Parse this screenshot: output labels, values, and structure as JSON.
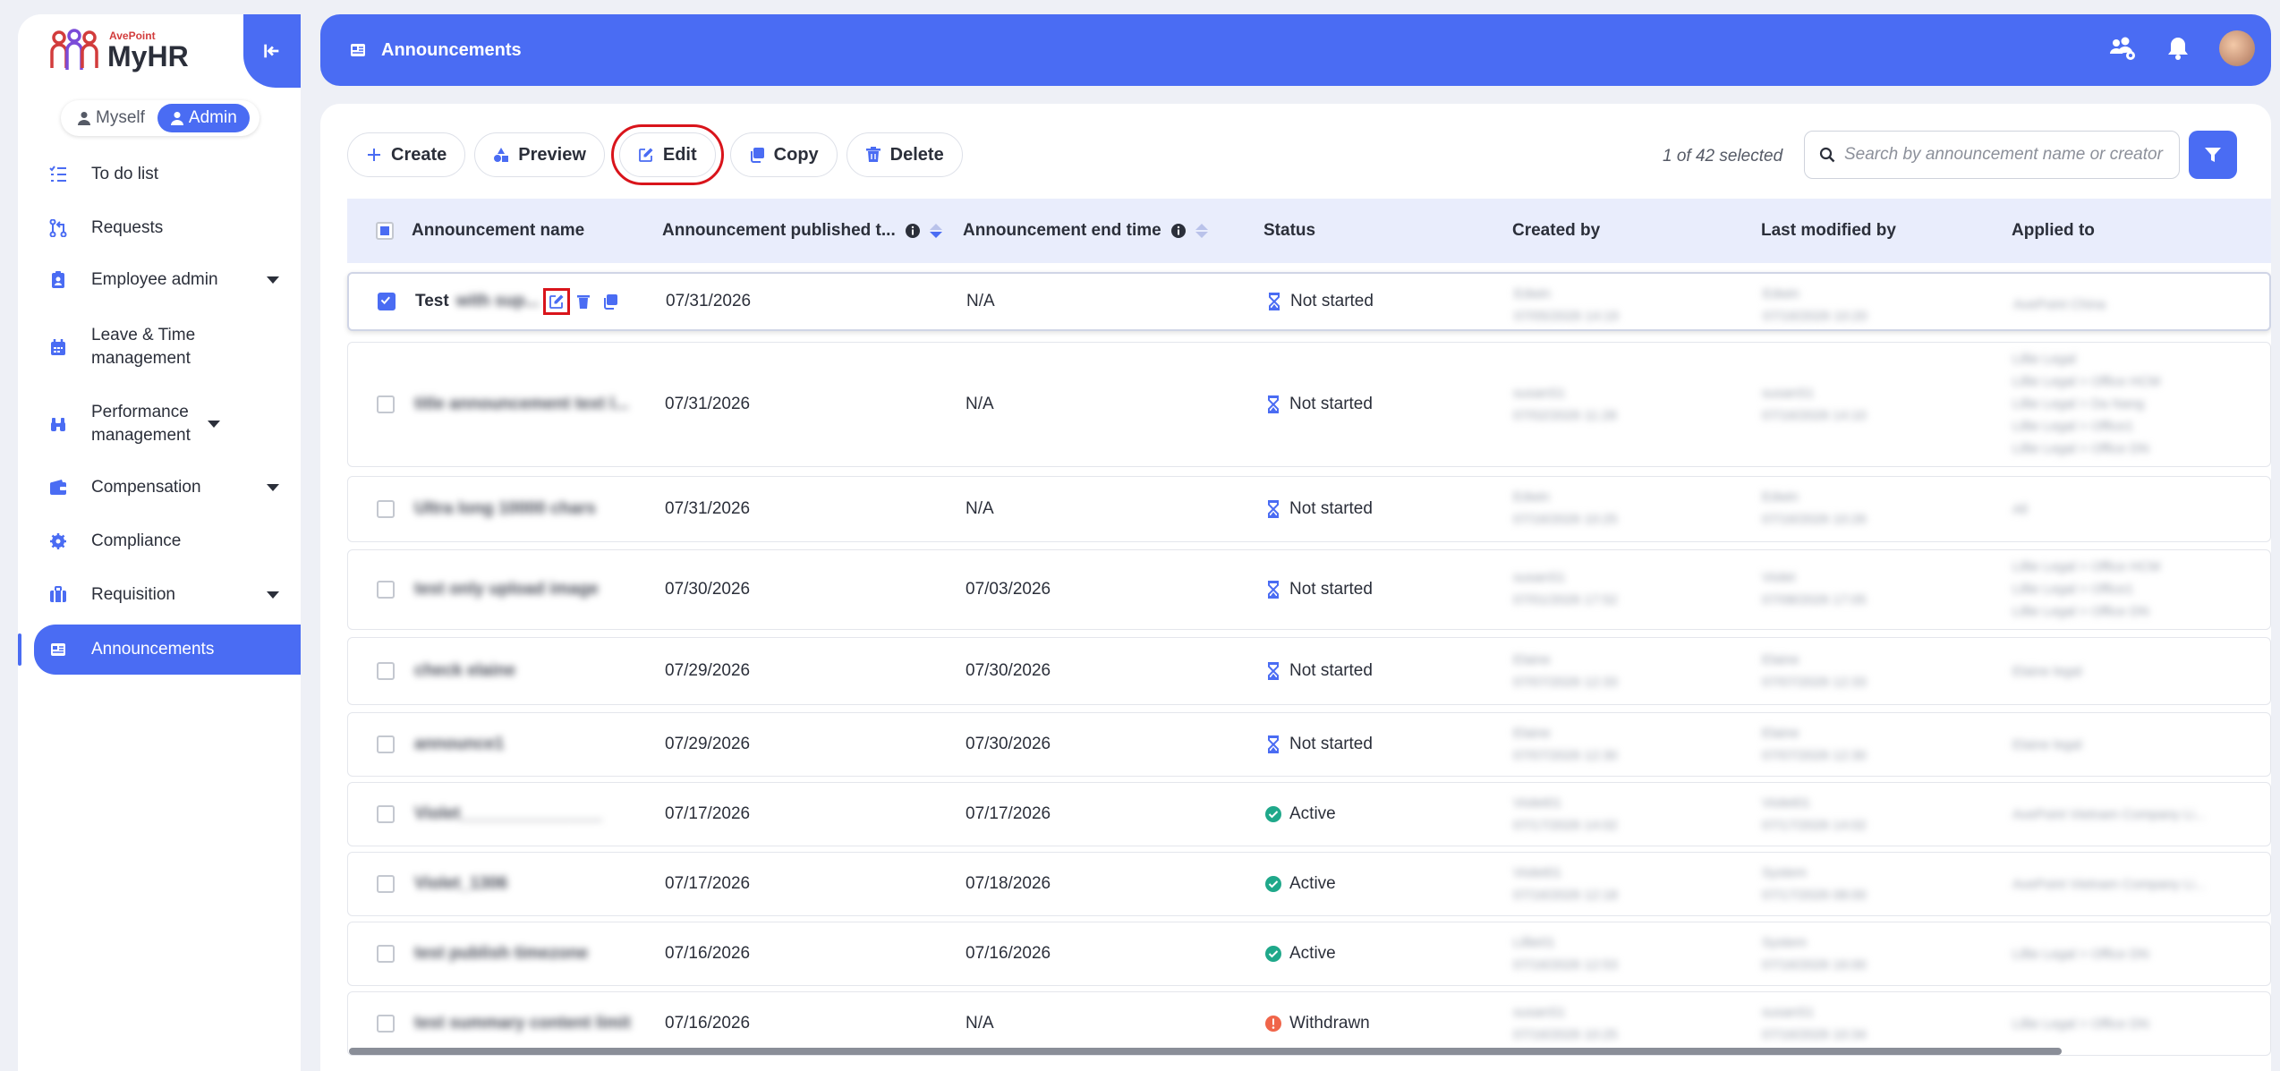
{
  "app": {
    "brand_sub": "AvePoint",
    "brand_name": "MyHR"
  },
  "role_switch": {
    "myself": "Myself",
    "admin": "Admin"
  },
  "sidebar": {
    "items": [
      {
        "label": "To do list",
        "icon": "checklist-icon"
      },
      {
        "label": "Requests",
        "icon": "pull-request-icon"
      },
      {
        "label": "Employee admin",
        "icon": "id-badge-icon"
      },
      {
        "label": "Leave & Time management",
        "icon": "calendar-icon"
      },
      {
        "label": "Performance management",
        "icon": "binoculars-icon"
      },
      {
        "label": "Compensation",
        "icon": "wallet-icon"
      },
      {
        "label": "Compliance",
        "icon": "gear-shield-icon"
      },
      {
        "label": "Requisition",
        "icon": "briefcase-icon"
      },
      {
        "label": "Announcements",
        "icon": "newspaper-icon"
      }
    ]
  },
  "header": {
    "title": "Announcements"
  },
  "toolbar": {
    "create": "Create",
    "preview": "Preview",
    "edit": "Edit",
    "copy": "Copy",
    "delete": "Delete",
    "selected_count": "1 of 42 selected"
  },
  "search": {
    "placeholder": "Search by announcement name or creator"
  },
  "table": {
    "columns": {
      "name": "Announcement name",
      "published": "Announcement published t...",
      "end": "Announcement end time",
      "status": "Status",
      "created_by": "Created by",
      "modified_by": "Last modified by",
      "applied_to": "Applied to"
    },
    "rows": [
      {
        "name": "Test",
        "name_rest": "with sup...",
        "published": "07/31/2026",
        "end": "N/A",
        "status": "Not started",
        "status_type": "pending",
        "created_by": "Edwin",
        "created_at": "07/05/2026 14:19",
        "modified_by": "Edwin",
        "modified_at": "07/16/2026 10:20",
        "applied_to": [
          "AvePoint China"
        ]
      },
      {
        "name": "title announcement text l...",
        "published": "07/31/2026",
        "end": "N/A",
        "status": "Not started",
        "status_type": "pending",
        "created_by": "susanS1",
        "created_at": "07/02/2026 11:28",
        "modified_by": "susanS1",
        "modified_at": "07/16/2026 14:10",
        "applied_to": [
          "Lillie Legal",
          "Lillie Legal > Office HCM",
          "Lillie Legal > Da Nang",
          "Lillie Legal > Office1",
          "Lillie Legal > Office DN"
        ]
      },
      {
        "name": "Ultra long 10000 chars",
        "published": "07/31/2026",
        "end": "N/A",
        "status": "Not started",
        "status_type": "pending",
        "created_by": "Edwin",
        "created_at": "07/16/2026 10:25",
        "modified_by": "Edwin",
        "modified_at": "07/16/2026 10:26",
        "applied_to": [
          "All"
        ]
      },
      {
        "name": "test only upload image",
        "published": "07/30/2026",
        "end": "07/03/2026",
        "status": "Not started",
        "status_type": "pending",
        "created_by": "susanS1",
        "created_at": "07/01/2026 17:52",
        "modified_by": "Violet",
        "modified_at": "07/08/2026 17:05",
        "applied_to": [
          "Lillie Legal > Office HCM",
          "Lillie Legal > Office1",
          "Lillie Legal > Office DN"
        ]
      },
      {
        "name": "check elaine",
        "published": "07/29/2026",
        "end": "07/30/2026",
        "status": "Not started",
        "status_type": "pending",
        "created_by": "Elaine",
        "created_at": "07/07/2026 12:33",
        "modified_by": "Elaine",
        "modified_at": "07/07/2026 12:33",
        "applied_to": [
          "Elaine legal"
        ]
      },
      {
        "name": "announce1",
        "published": "07/29/2026",
        "end": "07/30/2026",
        "status": "Not started",
        "status_type": "pending",
        "created_by": "Elaine",
        "created_at": "07/07/2026 12:30",
        "modified_by": "Elaine",
        "modified_at": "07/07/2026 12:30",
        "applied_to": [
          "Elaine legal"
        ]
      },
      {
        "name": "Violet_______________",
        "published": "07/17/2026",
        "end": "07/17/2026",
        "status": "Active",
        "status_type": "active",
        "created_by": "Violet01",
        "created_at": "07/17/2026 14:02",
        "modified_by": "Violet01",
        "modified_at": "07/17/2026 14:02",
        "applied_to": [
          "AvePoint Vietnam Company Li..."
        ]
      },
      {
        "name": "Violet_1306",
        "published": "07/17/2026",
        "end": "07/18/2026",
        "status": "Active",
        "status_type": "active",
        "created_by": "Violet01",
        "created_at": "07/16/2026 12:18",
        "modified_by": "System",
        "modified_at": "07/17/2026 08:00",
        "applied_to": [
          "AvePoint Vietnam Company Li..."
        ]
      },
      {
        "name": "test publish timezone",
        "published": "07/16/2026",
        "end": "07/16/2026",
        "status": "Active",
        "status_type": "active",
        "created_by": "Lillie01",
        "created_at": "07/16/2026 12:53",
        "modified_by": "System",
        "modified_at": "07/16/2026 16:00",
        "applied_to": [
          "Lillie Legal > Office DN"
        ]
      },
      {
        "name": "test summary content limit",
        "published": "07/16/2026",
        "end": "N/A",
        "status": "Withdrawn",
        "status_type": "withdrawn",
        "created_by": "susanS1",
        "created_at": "07/16/2026 10:25",
        "modified_by": "susanS1",
        "modified_at": "07/16/2026 10:34",
        "applied_to": [
          "Lillie Legal > Office DN"
        ]
      }
    ]
  },
  "colors": {
    "accent": "#4a6cf3",
    "active": "#1fa88a",
    "withdrawn": "#f0654a",
    "highlight": "#d9141b"
  }
}
